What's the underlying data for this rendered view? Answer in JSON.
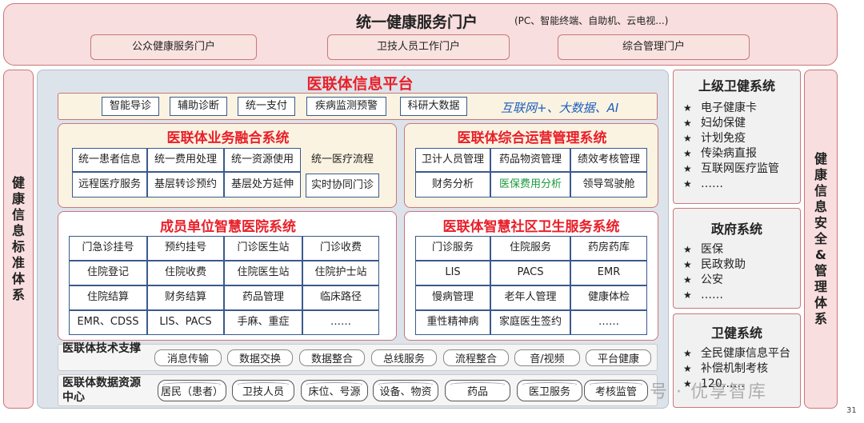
{
  "portal": {
    "title": "统一健康服务门户",
    "subtitle": "(PC、智能终端、自助机、云电视...)",
    "items": [
      "公众健康服务门户",
      "卫技人员工作门户",
      "综合管理门户"
    ]
  },
  "left_side": "健康信息标准体系",
  "right_side": "健康信息安全&管理体系",
  "platform": {
    "title": "医联体信息平台",
    "features": [
      "智能导诊",
      "辅助诊断",
      "统一支付",
      "疾病监测预警",
      "科研大数据"
    ],
    "tagline": "互联网+、大数据、AI"
  },
  "fusion": {
    "title": "医联体业务融合系统",
    "cells": [
      "统一患者信息",
      "统一费用处理",
      "统一资源使用",
      "统一医疗流程",
      "远程医疗服务",
      "基层转诊预约",
      "基层处方延伸",
      "实时协同门诊"
    ]
  },
  "ops": {
    "title": "医联体综合运营管理系统",
    "cells": [
      "卫计人员管理",
      "药品物资管理",
      "绩效考核管理",
      "财务分析",
      "医保费用分析",
      "领导驾驶舱"
    ]
  },
  "hospital": {
    "title": "成员单位智慧医院系统",
    "cells": [
      "门急诊挂号",
      "预约挂号",
      "门诊医生站",
      "门诊收费",
      "住院登记",
      "住院收费",
      "住院医生站",
      "住院护士站",
      "住院结算",
      "财务结算",
      "药品管理",
      "临床路径",
      "EMR、CDSS",
      "LIS、PACS",
      "手麻、重症",
      "……"
    ]
  },
  "community": {
    "title": "医联体智慧社区卫生服务系统",
    "cells": [
      "门诊服务",
      "住院服务",
      "药房药库",
      "LIS",
      "PACS",
      "EMR",
      "慢病管理",
      "老年人管理",
      "健康体检",
      "重性精神病",
      "家庭医生签约",
      "……"
    ]
  },
  "tech": {
    "label": "医联体技术支撑",
    "items": [
      "消息传输",
      "数据交换",
      "数据整合",
      "总线服务",
      "流程整合",
      "音/视频",
      "平台健康"
    ]
  },
  "data_center": {
    "label": "医联体数据资源中心",
    "items": [
      "居民（患者）",
      "卫技人员",
      "床位、号源",
      "设备、物资",
      "药品",
      "医卫服务",
      "考核监管"
    ]
  },
  "gov_upper": {
    "title": "上级卫健系统",
    "items": [
      "电子健康卡",
      "妇幼保健",
      "计划免疫",
      "传染病直报",
      "互联网医疗监管",
      "……"
    ]
  },
  "gov": {
    "title": "政府系统",
    "items": [
      "医保",
      "民政救助",
      "公安",
      "……"
    ]
  },
  "health_sys": {
    "title": "卫健系统",
    "items": [
      "全民健康信息平台",
      "补偿机制考核",
      "120……"
    ]
  },
  "watermark": "公众号 · 优享智库",
  "page_number": "31",
  "colors": {
    "accent": "#e8202a",
    "tagline": "#1f5fbf",
    "green": "#1a9a3a"
  }
}
